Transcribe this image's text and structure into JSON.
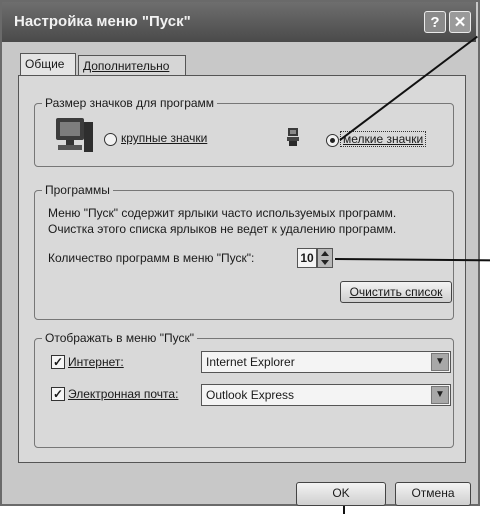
{
  "window": {
    "title": "Настройка меню \"Пуск\"",
    "help": "?",
    "close": "✕"
  },
  "tabs": [
    {
      "label": "Общие"
    },
    {
      "label": "Дополнительно"
    }
  ],
  "icon_size": {
    "legend": "Размер значков для программ",
    "large_label": "крупные значки",
    "small_label": "мелкие значки",
    "selected": "small"
  },
  "programs": {
    "legend": "Программы",
    "info_line1": "Меню \"Пуск\" содержит ярлыки часто используемых программ.",
    "info_line2": "Очистка этого списка ярлыков не ведет к удалению программ.",
    "count_label": "Количество программ в меню \"Пуск\":",
    "count_value": "10",
    "clear_button": "Очистить список"
  },
  "show_in_menu": {
    "legend": "Отображать в меню \"Пуск\"",
    "internet_label": "Интернет:",
    "internet_checked": true,
    "internet_value": "Internet Explorer",
    "email_label": "Электронная почта:",
    "email_checked": true,
    "email_value": "Outlook Express"
  },
  "footer": {
    "ok": "OK",
    "cancel": "Отмена"
  },
  "icons": {
    "large": "computer-large-icon",
    "small": "computer-small-icon"
  },
  "colors": {
    "dialog_bg": "#d9d9d9",
    "title_bg": "#4a4a4a"
  }
}
